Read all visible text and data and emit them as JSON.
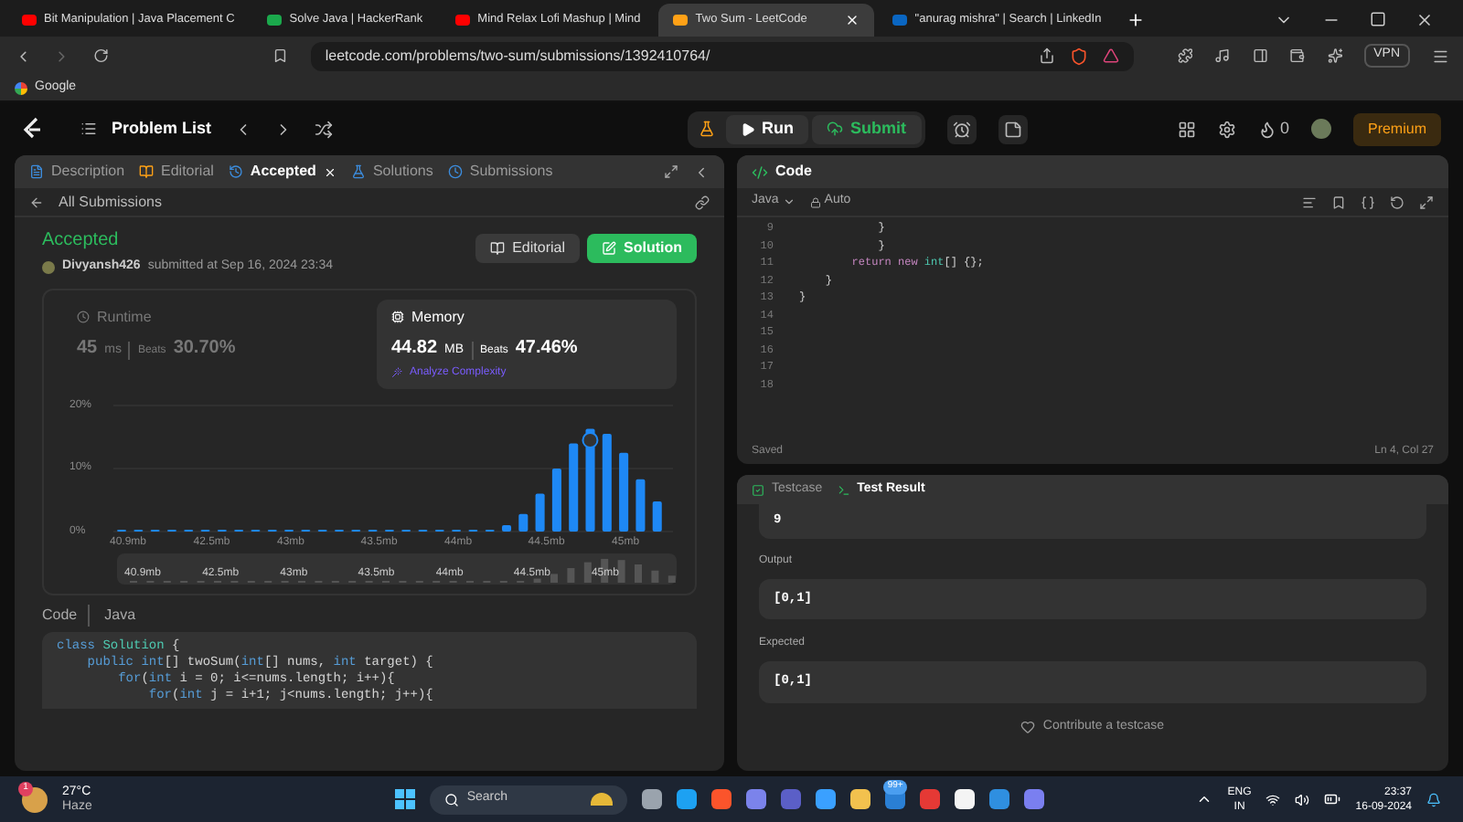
{
  "browser": {
    "tabs": [
      {
        "title": "Bit Manipulation | Java Placement C",
        "color": "#ff0000",
        "selected": false
      },
      {
        "title": "Solve Java | HackerRank",
        "color": "#1ba94c",
        "selected": false
      },
      {
        "title": "Mind Relax Lofi Mashup | Mind",
        "color": "#ff0000",
        "selected": false
      },
      {
        "title": "Two Sum - LeetCode",
        "color": "#ffa116",
        "selected": true
      },
      {
        "title": "\"anurag mishra\" | Search | LinkedIn",
        "color": "#0a66c2",
        "selected": false
      }
    ],
    "url": "leetcode.com/problems/two-sum/submissions/1392410764/",
    "vpn": "VPN",
    "bookmarks": [
      "Google"
    ]
  },
  "header": {
    "problem_list": "Problem List",
    "run": "Run",
    "submit": "Submit",
    "streak": "0",
    "premium": "Premium"
  },
  "left_panel": {
    "tabs": [
      {
        "label": "Description",
        "selected": false
      },
      {
        "label": "Editorial",
        "selected": false
      },
      {
        "label": "Accepted",
        "selected": true
      },
      {
        "label": "Solutions",
        "selected": false
      },
      {
        "label": "Submissions",
        "selected": false
      }
    ],
    "back": "All Submissions",
    "status": "Accepted",
    "user": "Divyansh426",
    "submitted": "submitted at Sep 16, 2024 23:34",
    "editorial_button": "Editorial",
    "solution_button": "Solution",
    "stats": [
      {
        "label": "Runtime",
        "value": "45",
        "unit": "ms",
        "beats_label": "Beats",
        "beats": "30.70%",
        "selected": false
      },
      {
        "label": "Memory",
        "value": "44.82",
        "unit": "MB",
        "beats_label": "Beats",
        "beats": "47.46%",
        "selected": true
      }
    ],
    "analyze": "Analyze Complexity",
    "chart_data": {
      "type": "bar",
      "ylim": [
        0,
        20
      ],
      "yticks": [
        {
          "value": 0,
          "label": "0%"
        },
        {
          "value": 10,
          "label": "10%"
        },
        {
          "value": 20,
          "label": "20%"
        }
      ],
      "series": [
        {
          "color": "#1e88f5",
          "values": [
            0.3,
            0.3,
            0.3,
            0.3,
            0.3,
            0.3,
            0.3,
            0.3,
            0.3,
            0.3,
            0.3,
            0.3,
            0.3,
            0.3,
            0.3,
            0.3,
            0.3,
            0.3,
            0.3,
            0.3,
            0.3,
            0.3,
            0.3,
            1,
            2.8,
            6,
            10,
            14,
            16.3,
            15.5,
            12.5,
            8.3,
            4.8
          ]
        }
      ]
    },
    "x_labels": [
      "40.9mb",
      "42.5mb",
      "43mb",
      "43.5mb",
      "44mb",
      "44.5mb",
      "45mb"
    ],
    "brush_labels": [
      "40.9mb",
      "42.5mb",
      "43mb",
      "43.5mb",
      "44mb",
      "44.5mb",
      "45mb"
    ],
    "code_label": "Code",
    "code_language": "Java",
    "code": [
      [
        {
          "text": "class ",
          "kind": "kw"
        },
        {
          "text": "Solution",
          "kind": "type"
        },
        {
          "text": " {",
          "kind": "plain"
        }
      ],
      [
        {
          "text": "    public ",
          "kind": "kw"
        },
        {
          "text": "int",
          "kind": "kw"
        },
        {
          "text": "[] twoSum(",
          "kind": "plain"
        },
        {
          "text": "int",
          "kind": "kw"
        },
        {
          "text": "[] nums, ",
          "kind": "plain"
        },
        {
          "text": "int",
          "kind": "kw"
        },
        {
          "text": " target) {",
          "kind": "plain"
        }
      ],
      [
        {
          "text": "        for",
          "kind": "kw"
        },
        {
          "text": "(",
          "kind": "plain"
        },
        {
          "text": "int",
          "kind": "kw"
        },
        {
          "text": " i = 0; i<=nums.length; i++){",
          "kind": "plain"
        }
      ],
      [
        {
          "text": "            for",
          "kind": "kw"
        },
        {
          "text": "(",
          "kind": "plain"
        },
        {
          "text": "int",
          "kind": "kw"
        },
        {
          "text": " j = i+1; j<nums.length; j++){",
          "kind": "plain"
        }
      ]
    ]
  },
  "right_panel": {
    "title": "Code",
    "language": "Java",
    "mode": "Auto",
    "lines": [
      {
        "number": "9",
        "code": [
          {
            "text": "            }",
            "kind": "plain"
          }
        ]
      },
      {
        "number": "10",
        "code": [
          {
            "text": "            }",
            "kind": "plain"
          }
        ]
      },
      {
        "number": "11",
        "code": [
          {
            "text": "        return new ",
            "kind": "kw2"
          },
          {
            "text": "int",
            "kind": "type"
          },
          {
            "text": "[] {};",
            "kind": "plain"
          }
        ]
      },
      {
        "number": "12",
        "code": [
          {
            "text": "    }",
            "kind": "plain"
          }
        ]
      },
      {
        "number": "13",
        "code": [
          {
            "text": "}",
            "kind": "plain"
          }
        ]
      },
      {
        "number": "14"
      },
      {
        "number": "15"
      },
      {
        "number": "16"
      },
      {
        "number": "17"
      },
      {
        "number": "18"
      }
    ],
    "saved": "Saved",
    "cursor": "Ln 4, Col 27",
    "result_tabs": [
      {
        "label": "Testcase",
        "selected": false
      },
      {
        "label": "Test Result",
        "selected": true
      }
    ],
    "input_value": "9",
    "output_label": "Output",
    "output": "[0,1]",
    "expected_label": "Expected",
    "expected": "[0,1]",
    "contribute": "Contribute a testcase"
  },
  "taskbar": {
    "weather_badge": "1",
    "temperature": "27°C",
    "weather": "Haze",
    "search": "Search",
    "app_badge": "99+",
    "language": "ENG",
    "region": "IN",
    "time": "23:37",
    "date": "16-09-2024"
  }
}
